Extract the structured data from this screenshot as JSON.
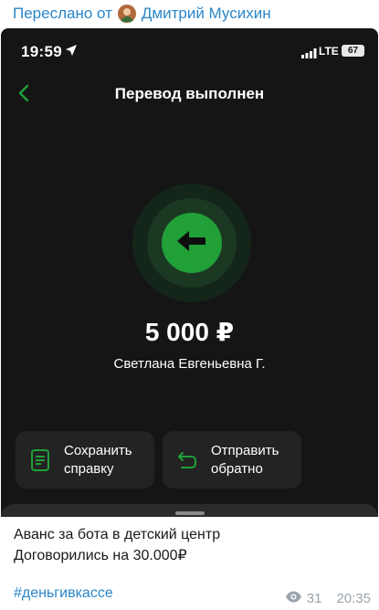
{
  "forward": {
    "prefix": "Переслано от",
    "author": "Дмитрий Мусихин",
    "avatar_icon": "user-avatar"
  },
  "screenshot": {
    "status_bar": {
      "time": "19:59",
      "network": "LTE",
      "battery": "67",
      "icons": [
        "location-arrow-icon",
        "signal-bars-icon"
      ]
    },
    "header": {
      "title": "Перевод выполнен",
      "back_icon": "chevron-left-icon"
    },
    "transfer": {
      "icon": "arrow-left-icon",
      "amount": "5 000 ₽",
      "recipient": "Светлана Евгеньевна Г."
    },
    "actions": [
      {
        "label": "Сохранить справку",
        "icon": "document-icon"
      },
      {
        "label": "Отправить обратно",
        "icon": "return-arrow-icon"
      }
    ],
    "colors": {
      "accent": "#21a038",
      "background": "#151515",
      "card": "#232323"
    }
  },
  "message": {
    "line1": "Аванс за бота в детский центр",
    "line2": "Договорились на 30.000₽",
    "hashtag": "#деньгивкассе",
    "views": "31",
    "time": "20:35",
    "views_icon": "eye-icon"
  }
}
